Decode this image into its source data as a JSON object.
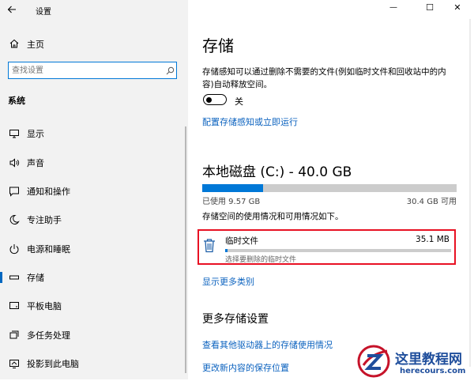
{
  "window": {
    "title": "设置",
    "controls": {
      "minimize": "—",
      "maximize": "☐",
      "close": "✕"
    }
  },
  "sidebar": {
    "home_label": "主页",
    "search_placeholder": "查找设置",
    "section_label": "系统",
    "items": [
      {
        "label": "显示",
        "icon": "display-icon"
      },
      {
        "label": "声音",
        "icon": "speaker-icon"
      },
      {
        "label": "通知和操作",
        "icon": "notification-icon"
      },
      {
        "label": "专注助手",
        "icon": "moon-icon"
      },
      {
        "label": "电源和睡眠",
        "icon": "power-icon"
      },
      {
        "label": "存储",
        "icon": "storage-icon",
        "selected": true
      },
      {
        "label": "平板电脑",
        "icon": "tablet-icon"
      },
      {
        "label": "多任务处理",
        "icon": "multitask-icon"
      },
      {
        "label": "投影到此电脑",
        "icon": "project-icon"
      }
    ]
  },
  "main": {
    "title": "存储",
    "description": "存储感知可以通过删除不需要的文件(例如临时文件和回收站中的内容)自动释放空间。",
    "toggle": {
      "state_label": "关",
      "on": false
    },
    "configure_link": "配置存储感知或立即运行",
    "disk": {
      "title": "本地磁盘 (C:) - 40.0 GB",
      "used_label": "已使用 9.57 GB",
      "free_label": "30.4 GB 可用",
      "used_fraction": 0.239,
      "usage_description": "存储空间的使用情况和可用情况如下。"
    },
    "temp_files": {
      "name": "临时文件",
      "size": "35.1 MB",
      "hint": "选择要删除的临时文件",
      "fill_fraction": 0.01
    },
    "show_more_link": "显示更多类别",
    "more_settings": {
      "heading": "更多存储设置",
      "links": [
        "查看其他驱动器上的存储使用情况",
        "更改新内容的保存位置"
      ]
    }
  },
  "watermark": {
    "site_name": "这里教程网",
    "url": "herecours.com"
  },
  "colors": {
    "accent": "#0078d7",
    "link": "#0b62bf",
    "highlight_border": "#e81123",
    "sidebar_bg": "#f2f2f2"
  }
}
